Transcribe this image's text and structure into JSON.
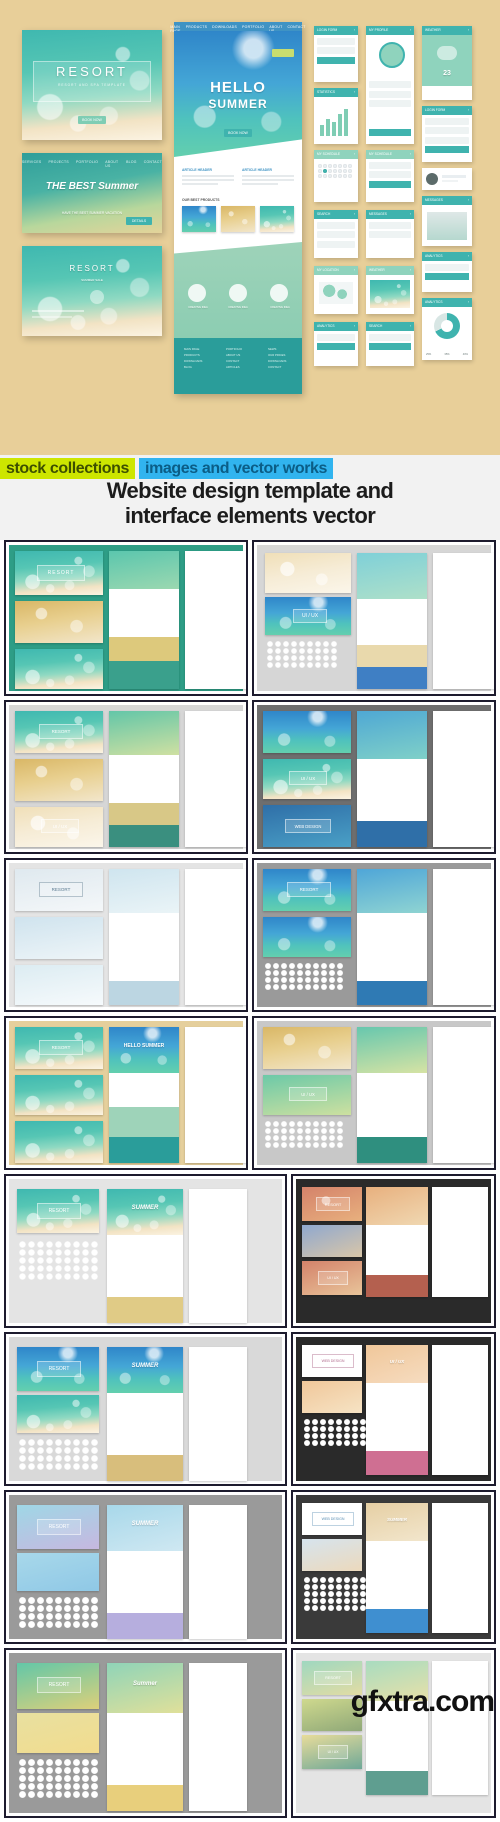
{
  "hero": {
    "background_color": "#e8cf99",
    "banners": [
      {
        "id": "resort-card",
        "title": "RESORT",
        "subtitle": "RESORT AND SPA TEMPLATE",
        "button": "BOOK NOW",
        "style": "teal-bokeh"
      },
      {
        "id": "the-best-summer-card",
        "title": "THE BEST Summer",
        "subtitle": "HAVE THE BEST SUMMER VACATION",
        "button": "DETAILS",
        "style": "teal-gradient",
        "nav": [
          "SERVICES",
          "PROJECTS",
          "PORTFOLIO",
          "ABOUT US",
          "BLOG",
          "CONTACT"
        ]
      },
      {
        "id": "resort-bottom-card",
        "title": "RESORT",
        "subtitle": "SUMMER SALE",
        "style": "teal-bokeh-light"
      }
    ],
    "webpage": {
      "id": "hello-summer-page",
      "headline_line1": "HELLO",
      "headline_line2": "SUMMER",
      "button": "BOOK NOW",
      "nav": [
        "MAIN PAGE",
        "PRODUCTS",
        "DOWNLOADS",
        "PORTFOLIO",
        "ABOUT US",
        "CONTACT",
        "BLOG"
      ],
      "articles": [
        {
          "title": "ARTICLE HEADER"
        },
        {
          "title": "ARTICLE HEADER"
        }
      ],
      "section_title": "OUR BEST PRODUCTS",
      "features": [
        {
          "label": "CREATIVE IDEA"
        },
        {
          "label": "CREATIVE IDEA"
        },
        {
          "label": "CREATIVE IDEA"
        }
      ],
      "footer_columns": [
        {
          "items": [
            "MAIN PAGE",
            "PRODUCTS",
            "DOWNLOADS",
            "BLOG"
          ]
        },
        {
          "items": [
            "PORTFOLIO",
            "ABOUT US",
            "CONTACT",
            "ARTICLES"
          ]
        },
        {
          "items": [
            "NEWS",
            "OUR PRICES",
            "DOWNLOADS",
            "CONTACT"
          ]
        }
      ]
    },
    "ui_cards": [
      {
        "id": "login-card",
        "title": "LOGIN FORM",
        "fields": [
          "YOUR NAME",
          "PASSWORD"
        ],
        "button": "LOGIN"
      },
      {
        "id": "profile-card",
        "title": "MY PROFILE",
        "fields": [
          "YOUR NAME",
          "YOUR EMAIL",
          "DATE"
        ],
        "button": "SAVE"
      },
      {
        "id": "weather-card",
        "title": "WEATHER",
        "icon": "rain-cloud-icon",
        "temperature": "23"
      },
      {
        "id": "statistics-card",
        "title": "STATISTICS",
        "chart": "bar-chart-icon"
      },
      {
        "id": "calendar-card",
        "title": "MY SCHEDULE",
        "widget": "calendar-icon"
      },
      {
        "id": "location-card",
        "title": "MY LOCATION",
        "widget": "world-map-icon"
      },
      {
        "id": "chat-card",
        "title": "MESSAGES",
        "widget": "chat-bubble-icon"
      },
      {
        "id": "search-card",
        "title": "SEARCH",
        "placeholder": "TYPE HERE",
        "button": "SEARCH"
      },
      {
        "id": "analytics-card",
        "title": "ANALYTICS",
        "widget": "donut-chart-icon",
        "legend": [
          "25%",
          "35%",
          "40%"
        ]
      }
    ]
  },
  "title_block": {
    "tag_left": "stock collections",
    "tag_right": "images and vector works",
    "tag_left_color": "#cde600",
    "tag_right_color": "#31b4ef",
    "title_line1": "Website design template and",
    "title_line2": "interface elements vector"
  },
  "gallery": {
    "rows": [
      {
        "cells": [
          {
            "id": "thumb-1",
            "frame": "#2e9d86",
            "label": "RESORT",
            "accent": "teal-gold"
          },
          {
            "id": "thumb-2",
            "frame": "#d6d6d6",
            "label": "UI / UX",
            "accent": "blue-sand"
          }
        ]
      },
      {
        "cells": [
          {
            "id": "thumb-3",
            "frame": "#d6d6d6",
            "label": "RESORT",
            "accent": "green-gold"
          },
          {
            "id": "thumb-4",
            "frame": "#6e6e6e",
            "label": "UI / UX",
            "accent": "blue-teal",
            "label2": "WEB DESIGN"
          }
        ]
      },
      {
        "cells": [
          {
            "id": "thumb-5",
            "frame": "#e4e4e4",
            "label": "RESORT",
            "accent": "pale-blue"
          },
          {
            "id": "thumb-6",
            "frame": "#9a9a9a",
            "label": "RESORT",
            "accent": "blue"
          }
        ]
      },
      {
        "cells": [
          {
            "id": "thumb-7",
            "frame": "#e5cf9c",
            "label": "HELLO SUMMER",
            "accent": "teal"
          },
          {
            "id": "thumb-8",
            "frame": "#c8c8c8",
            "label": "UI / UX",
            "accent": "green-gold"
          }
        ]
      },
      {
        "cells": [
          {
            "id": "thumb-9",
            "frame": "#e4e4e4",
            "label": "RESORT",
            "accent": "teal-sand",
            "label2": "SUMMER"
          },
          {
            "id": "thumb-10",
            "frame": "#2a2a2a",
            "label": "RESORT",
            "accent": "orange-pink",
            "label2": "UI / UX"
          }
        ]
      },
      {
        "cells": [
          {
            "id": "thumb-11",
            "frame": "#d9d9d9",
            "label": "RESORT",
            "accent": "blue-gold",
            "label2": "SUMMER"
          },
          {
            "id": "thumb-12",
            "frame": "#2a2a2a",
            "label": "WEB DESIGN",
            "accent": "pink-gold",
            "label2": "UI / UX"
          }
        ]
      },
      {
        "cells": [
          {
            "id": "thumb-13",
            "frame": "#9a9a9a",
            "label": "RESORT",
            "accent": "violet-blue",
            "label2": "SUMMER"
          },
          {
            "id": "thumb-14",
            "frame": "#3a3a3a",
            "label": "WEB DESIGN",
            "accent": "blue-sand",
            "label2": "SUMMER"
          }
        ]
      },
      {
        "cells": [
          {
            "id": "thumb-15",
            "frame": "#9a9a9a",
            "label": "RESORT",
            "accent": "green-yellow",
            "label2": "Summer"
          },
          {
            "id": "thumb-16",
            "frame": "#e4e4e4",
            "label": "RESORT",
            "accent": "gold-green",
            "label2": "UI / UX"
          }
        ]
      }
    ]
  },
  "watermark": {
    "text": "gfxtra.com"
  }
}
